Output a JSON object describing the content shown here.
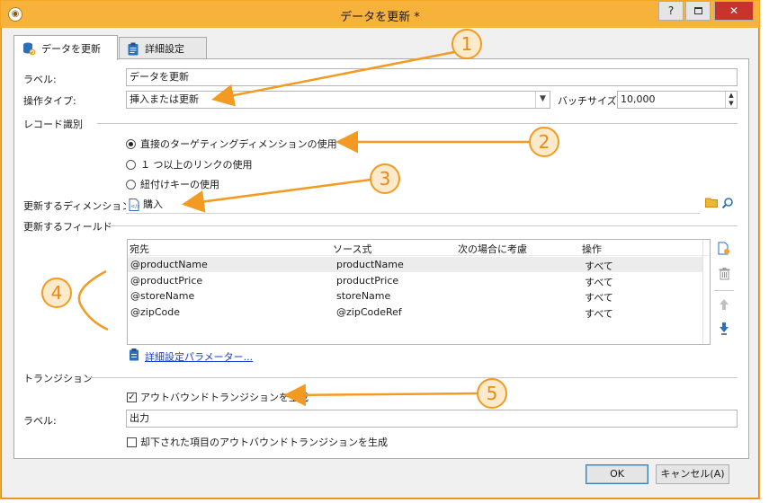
{
  "window": {
    "title": "データを更新 *",
    "help_label": "?",
    "close_label": "✕"
  },
  "tabs": [
    {
      "label": "データを更新",
      "icon": "database-update-icon",
      "active": true
    },
    {
      "label": "詳細設定",
      "icon": "clipboard-icon",
      "active": false
    }
  ],
  "form": {
    "label_caption": "ラベル:",
    "label_value": "データを更新",
    "op_type_caption": "操作タイプ:",
    "op_type_value": "挿入または更新",
    "batch_caption": "バッチサイズ:",
    "batch_value": "10,000"
  },
  "record_id": {
    "section": "レコード識別",
    "options": [
      {
        "label": "直接のターゲティングディメンションの使用",
        "selected": true
      },
      {
        "label": "１ つ以上のリンクの使用",
        "selected": false
      },
      {
        "label": "紐付けキーの使用",
        "selected": false
      }
    ],
    "dimension_caption": "更新するディメンション:",
    "dimension_value": "購入"
  },
  "fields": {
    "section": "更新するフィールド",
    "columns": [
      "宛先",
      "ソース式",
      "次の場合に考慮",
      "操作"
    ],
    "rows": [
      {
        "dest": "@productName",
        "source": "productName",
        "cond": "",
        "op": "すべて"
      },
      {
        "dest": "@productPrice",
        "source": "productPrice",
        "cond": "",
        "op": "すべて"
      },
      {
        "dest": "@storeName",
        "source": "storeName",
        "cond": "",
        "op": "すべて"
      },
      {
        "dest": "@zipCode",
        "source": "@zipCodeRef",
        "cond": "",
        "op": "すべて"
      }
    ],
    "advanced_link": "詳細設定パラメーター..."
  },
  "transition": {
    "section": "トランジション",
    "outbound_label": "アウトバウンドトランジションを生成",
    "outbound_checked": true,
    "label_caption": "ラベル:",
    "label_value": "出力",
    "rejected_label": "却下された項目のアウトバウンドトランジションを生成",
    "rejected_checked": false
  },
  "buttons": {
    "ok": "OK",
    "cancel": "キャンセル(A)"
  },
  "annotations": [
    "1",
    "2",
    "3",
    "4",
    "5"
  ],
  "colors": {
    "titlebar": "#f6b23a",
    "annotation": "#f29a21",
    "link": "#1a3fcf"
  }
}
